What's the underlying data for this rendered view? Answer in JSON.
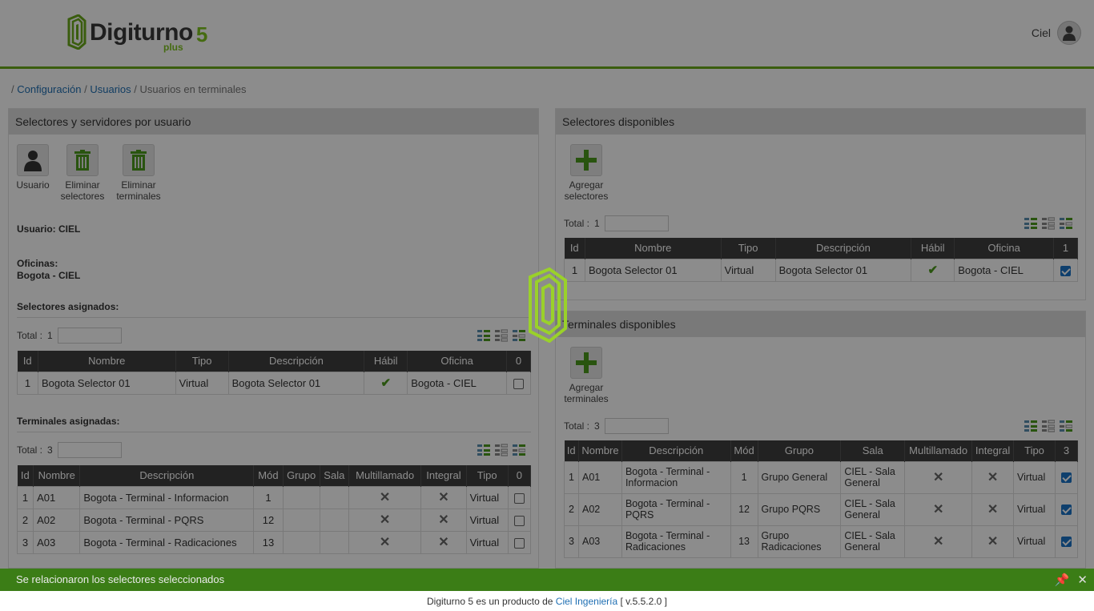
{
  "header": {
    "logo_text": "Digiturno",
    "logo_number": "5",
    "logo_plus": "plus",
    "user_name": "Ciel"
  },
  "breadcrumb": {
    "sep": "/",
    "item1": "Configuración",
    "item2": "Usuarios",
    "current": "Usuarios en terminales"
  },
  "left_panel": {
    "title": "Selectores y servidores por usuario",
    "tools": [
      {
        "label1": "Usuario",
        "label2": ""
      },
      {
        "label1": "Eliminar",
        "label2": "selectores"
      },
      {
        "label1": "Eliminar",
        "label2": "terminales"
      }
    ],
    "user_label": "Usuario: CIEL",
    "offices_label": "Oficinas:",
    "offices_value": "Bogota - CIEL",
    "assigned_selectors_title": "Selectores asignados:",
    "assigned_selectors_total_label": "Total :",
    "assigned_selectors_total": "1",
    "selectors_columns": [
      "Id",
      "Nombre",
      "Tipo",
      "Descripción",
      "Hábil",
      "Oficina",
      "0"
    ],
    "selectors_rows": [
      {
        "id": "1",
        "nombre": "Bogota Selector 01",
        "tipo": "Virtual",
        "descripcion": "Bogota Selector 01",
        "habil": true,
        "oficina": "Bogota - CIEL",
        "checked": false
      }
    ],
    "assigned_terminals_title": "Terminales asignadas:",
    "assigned_terminals_total_label": "Total :",
    "assigned_terminals_total": "3",
    "terminals_columns": [
      "Id",
      "Nombre",
      "Descripción",
      "Mód",
      "Grupo",
      "Sala",
      "Multillamado",
      "Integral",
      "Tipo",
      "0"
    ],
    "terminals_rows": [
      {
        "id": "1",
        "nombre": "A01",
        "descripcion": "Bogota - Terminal - Informacion",
        "mod": "1",
        "grupo": "",
        "sala": "",
        "tipo": "Virtual"
      },
      {
        "id": "2",
        "nombre": "A02",
        "descripcion": "Bogota - Terminal - PQRS",
        "mod": "12",
        "grupo": "",
        "sala": "",
        "tipo": "Virtual"
      },
      {
        "id": "3",
        "nombre": "A03",
        "descripcion": "Bogota - Terminal - Radicaciones",
        "mod": "13",
        "grupo": "",
        "sala": "",
        "tipo": "Virtual"
      }
    ]
  },
  "right_top_panel": {
    "title": "Selectores disponibles",
    "add_label1": "Agregar",
    "add_label2": "selectores",
    "total_label": "Total :",
    "total": "1",
    "columns": [
      "Id",
      "Nombre",
      "Tipo",
      "Descripción",
      "Hábil",
      "Oficina",
      "1"
    ],
    "rows": [
      {
        "id": "1",
        "nombre": "Bogota Selector 01",
        "tipo": "Virtual",
        "descripcion": "Bogota Selector 01",
        "habil": true,
        "oficina": "Bogota - CIEL",
        "checked": true
      }
    ]
  },
  "right_bottom_panel": {
    "title": "Terminales disponibles",
    "add_label1": "Agregar",
    "add_label2": "terminales",
    "total_label": "Total :",
    "total": "3",
    "columns": [
      "Id",
      "Nombre",
      "Descripción",
      "Mód",
      "Grupo",
      "Sala",
      "Multillamado",
      "Integral",
      "Tipo",
      "3"
    ],
    "rows": [
      {
        "id": "1",
        "nombre": "A01",
        "descripcion1": "Bogota - Terminal -",
        "descripcion2": "Informacion",
        "mod": "1",
        "grupo1": "Grupo General",
        "grupo2": "",
        "sala1": "CIEL - Sala",
        "sala2": "General",
        "tipo": "Virtual"
      },
      {
        "id": "2",
        "nombre": "A02",
        "descripcion1": "Bogota - Terminal -",
        "descripcion2": "PQRS",
        "mod": "12",
        "grupo1": "Grupo PQRS",
        "grupo2": "",
        "sala1": "CIEL - Sala",
        "sala2": "General",
        "tipo": "Virtual"
      },
      {
        "id": "3",
        "nombre": "A03",
        "descripcion1": "Bogota - Terminal -",
        "descripcion2": "Radicaciones",
        "mod": "13",
        "grupo1": "Grupo",
        "grupo2": "Radicaciones",
        "sala1": "CIEL - Sala",
        "sala2": "General",
        "tipo": "Virtual"
      }
    ]
  },
  "notification": {
    "message": "Se relacionaron los selectores seleccionados"
  },
  "footer": {
    "prefix": "Digiturno 5 es un producto de",
    "company": "Ciel Ingeniería",
    "version": "[ v.5.5.2.0 ]"
  },
  "colors": {
    "brand_green": "#7fc31f",
    "notify_green": "#3b7d16",
    "link_blue": "#1f6fb3",
    "table_header": "#3f3f3f"
  }
}
